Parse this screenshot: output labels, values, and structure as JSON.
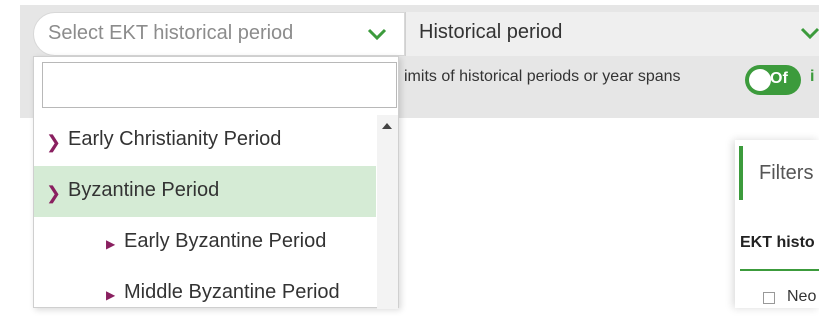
{
  "period_select": {
    "placeholder": "Select EKT historical period",
    "search_value": "",
    "items": [
      {
        "label": "Early Christianity Period",
        "level": 0,
        "selected": false
      },
      {
        "label": "Byzantine Period",
        "level": 0,
        "selected": true
      },
      {
        "label": "Early Byzantine Period",
        "level": 1,
        "selected": false
      },
      {
        "label": "Middle Byzantine Period",
        "level": 1,
        "selected": false
      }
    ]
  },
  "type_select": {
    "value": "Historical period"
  },
  "limits_toggle": {
    "label": "imits of historical periods or year spans",
    "state": "Of"
  },
  "filters_panel": {
    "title": "Filters",
    "section": "EKT histo",
    "option": "Neo"
  },
  "colors": {
    "accent": "#3c9b3c",
    "arrow": "#8a2060",
    "selected_row": "#d5ebd5"
  },
  "icons": {
    "dropdown": "chevron-down-icon",
    "expand": "chevron-right-icon",
    "info": "info-icon"
  }
}
